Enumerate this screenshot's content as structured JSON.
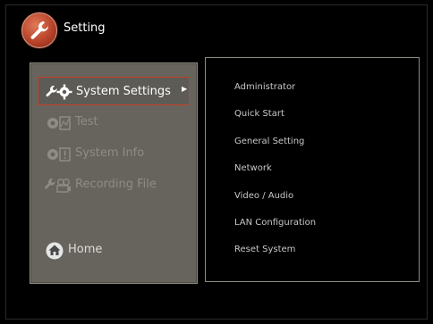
{
  "header": {
    "title": "Setting",
    "logo_icon": "wrench-icon",
    "accent": "#c5402a"
  },
  "left_menu": {
    "items": [
      {
        "label": "System Settings",
        "icon": "wrench-gear-icon",
        "active": true
      },
      {
        "label": "Test",
        "icon": "gear-chart-icon",
        "active": false
      },
      {
        "label": "System Info",
        "icon": "gear-info-icon",
        "active": false
      },
      {
        "label": "Recording File",
        "icon": "wrench-video-icon",
        "active": false
      }
    ],
    "home": {
      "label": "Home",
      "icon": "home-icon"
    }
  },
  "submenu": {
    "items": [
      "Administrator",
      "Quick Start",
      "General Setting",
      "Network",
      "Video / Audio",
      "LAN Configuration",
      "Reset System"
    ]
  }
}
